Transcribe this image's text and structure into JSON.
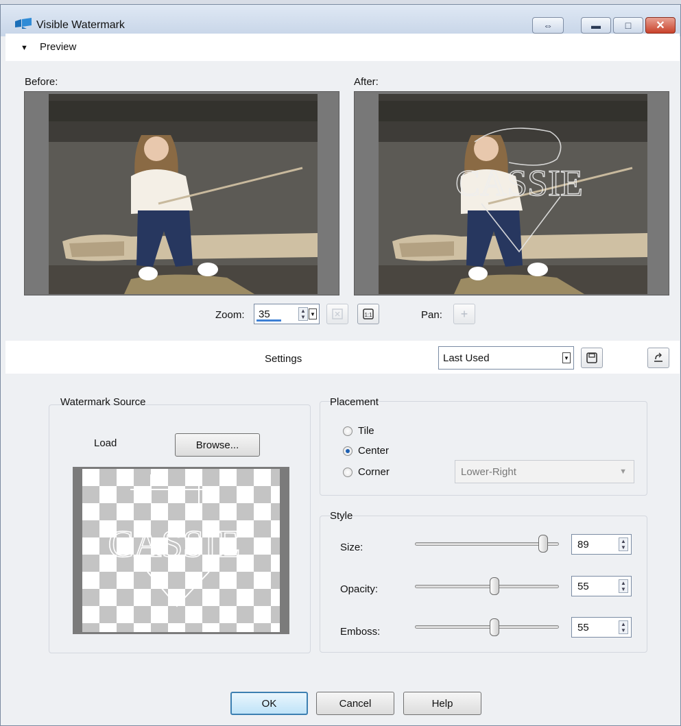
{
  "window": {
    "title": "Visible Watermark",
    "preview_label": "Preview"
  },
  "preview": {
    "before_label": "Before:",
    "after_label": "After:",
    "zoom_label": "Zoom:",
    "zoom_value": "35",
    "pan_label": "Pan:"
  },
  "settings": {
    "label": "Settings",
    "preset_value": "Last Used"
  },
  "watermark_source": {
    "group_label": "Watermark Source",
    "load_label": "Load",
    "browse_label": "Browse...",
    "watermark_text": "CASSIE"
  },
  "placement": {
    "group_label": "Placement",
    "options": [
      {
        "label": "Tile",
        "checked": false
      },
      {
        "label": "Center",
        "checked": true
      },
      {
        "label": "Corner",
        "checked": false
      }
    ],
    "corner_value": "Lower-Right"
  },
  "style": {
    "group_label": "Style",
    "sliders": [
      {
        "label": "Size:",
        "value": "89",
        "fraction": 0.89
      },
      {
        "label": "Opacity:",
        "value": "55",
        "fraction": 0.55
      },
      {
        "label": "Emboss:",
        "value": "55",
        "fraction": 0.55
      }
    ]
  },
  "footer": {
    "ok_label": "OK",
    "cancel_label": "Cancel",
    "help_label": "Help"
  },
  "colors": {
    "title_bar": "#c7d5e8",
    "close_button": "#c9422b",
    "accent": "#3c7fd4"
  }
}
